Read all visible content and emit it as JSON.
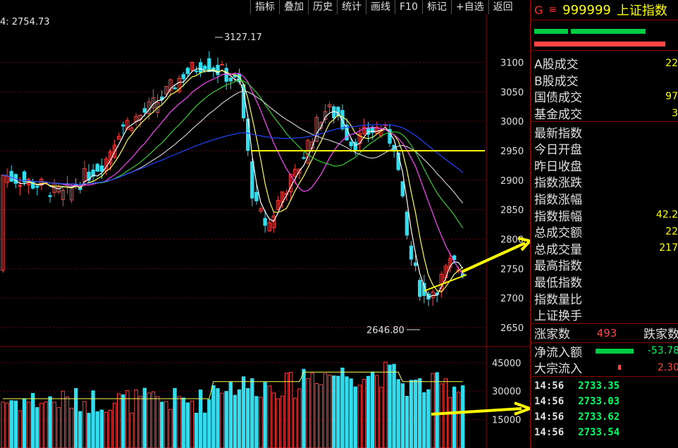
{
  "toolbar": [
    "指标",
    "叠加",
    "历史",
    "统计",
    "画线",
    "F10",
    "标记",
    "+自选",
    "返回"
  ],
  "ma_readout": "4: 2754.73",
  "chart_data": {
    "type": "candlestick",
    "price_axis": [
      "3100",
      "3050",
      "3000",
      "2950",
      "2900",
      "2850",
      "2800",
      "2750",
      "2700",
      "2650"
    ],
    "volume_axis": [
      "45000",
      "30000",
      "15000"
    ],
    "high_label": "3127.17",
    "low_label": "2646.80",
    "hline_price": 2950,
    "price_range": [
      2620,
      3170
    ],
    "volume_range": [
      0,
      52000
    ]
  },
  "panel": {
    "prefix": "G",
    "menu_icon": "≡",
    "code": "999999",
    "name": "上证指数",
    "bar_colors": [
      "#00cc44",
      "#ff4444"
    ],
    "rows1": [
      {
        "label": "A股成交",
        "value": "22"
      },
      {
        "label": "B股成交",
        "value": ""
      },
      {
        "label": "国债成交",
        "value": "97"
      },
      {
        "label": "基金成交",
        "value": "3"
      }
    ],
    "rows2": [
      {
        "label": "最新指数",
        "value": ""
      },
      {
        "label": "今日开盘",
        "value": ""
      },
      {
        "label": "昨日收盘",
        "value": ""
      },
      {
        "label": "指数涨跌",
        "value": ""
      },
      {
        "label": "指数涨幅",
        "value": ""
      },
      {
        "label": "指数振幅",
        "value": "42.2"
      },
      {
        "label": "总成交额",
        "value": "22"
      },
      {
        "label": "总成交量",
        "value": "217"
      },
      {
        "label": "最高指数",
        "value": ""
      },
      {
        "label": "最低指数",
        "value": ""
      },
      {
        "label": "指数量比",
        "value": ""
      },
      {
        "label": "上证换手",
        "value": ""
      }
    ],
    "up_label": "涨家数",
    "up_value": "493",
    "down_label": "跌家数",
    "inflow_label": "净流入额",
    "inflow_value": "-53.78",
    "block_label": "大宗流入",
    "block_value": "2.30",
    "ticks": [
      {
        "time": "14:56",
        "price": "2733.35"
      },
      {
        "time": "14:56",
        "price": "2733.03"
      },
      {
        "time": "14:56",
        "price": "2733.62"
      },
      {
        "time": "14:56",
        "price": "2733.54"
      }
    ]
  }
}
